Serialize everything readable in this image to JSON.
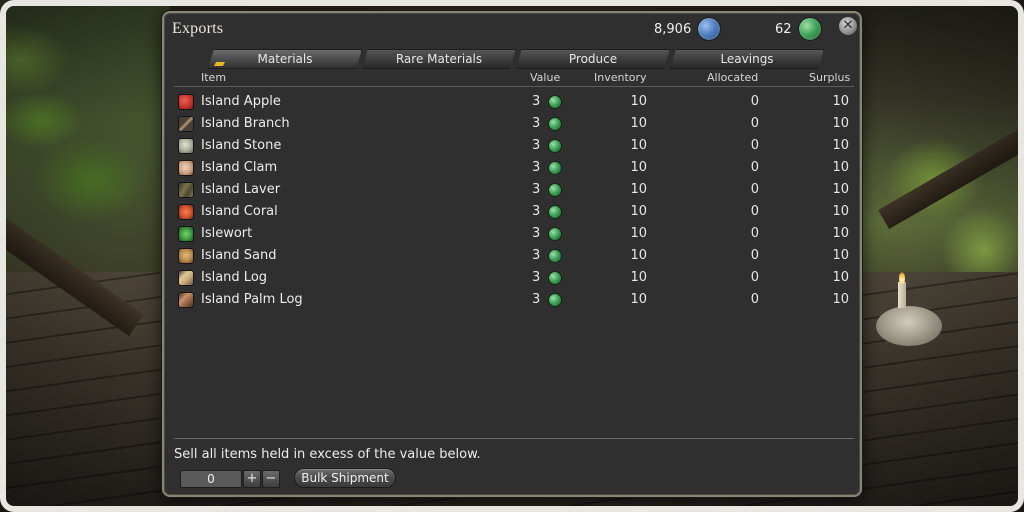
{
  "window": {
    "title": "Exports"
  },
  "currencies": [
    {
      "amount": "8,906",
      "icon": "seafarer-cowrie-icon",
      "color": "#4f7fc0"
    },
    {
      "amount": "62",
      "icon": "islander-cowrie-icon",
      "color": "#3fa55a"
    }
  ],
  "tabs": [
    {
      "label": "Materials",
      "active": true
    },
    {
      "label": "Rare Materials",
      "active": false
    },
    {
      "label": "Produce",
      "active": false
    },
    {
      "label": "Leavings",
      "active": false
    }
  ],
  "columns": {
    "item": "Item",
    "value": "Value",
    "inventory": "Inventory",
    "allocated": "Allocated",
    "surplus": "Surplus"
  },
  "items": [
    {
      "name": "Island Apple",
      "value": "3",
      "inventory": "10",
      "allocated": "0",
      "surplus": "10",
      "icon": "apple-icon",
      "color": "#c0302a"
    },
    {
      "name": "Island Branch",
      "value": "3",
      "inventory": "10",
      "allocated": "0",
      "surplus": "10",
      "icon": "branch-icon",
      "color": "#6e5a44"
    },
    {
      "name": "Island Stone",
      "value": "3",
      "inventory": "10",
      "allocated": "0",
      "surplus": "10",
      "icon": "stone-icon",
      "color": "#b8bca8"
    },
    {
      "name": "Island Clam",
      "value": "3",
      "inventory": "10",
      "allocated": "0",
      "surplus": "10",
      "icon": "clam-icon",
      "color": "#d8b49a"
    },
    {
      "name": "Island Laver",
      "value": "3",
      "inventory": "10",
      "allocated": "0",
      "surplus": "10",
      "icon": "laver-icon",
      "color": "#6a6440"
    },
    {
      "name": "Island Coral",
      "value": "3",
      "inventory": "10",
      "allocated": "0",
      "surplus": "10",
      "icon": "coral-icon",
      "color": "#d8502e"
    },
    {
      "name": "Islewort",
      "value": "3",
      "inventory": "10",
      "allocated": "0",
      "surplus": "10",
      "icon": "islewort-icon",
      "color": "#3e9a40"
    },
    {
      "name": "Island Sand",
      "value": "3",
      "inventory": "10",
      "allocated": "0",
      "surplus": "10",
      "icon": "sand-icon",
      "color": "#b88a4a"
    },
    {
      "name": "Island Log",
      "value": "3",
      "inventory": "10",
      "allocated": "0",
      "surplus": "10",
      "icon": "log-icon",
      "color": "#c8a878"
    },
    {
      "name": "Island Palm Log",
      "value": "3",
      "inventory": "10",
      "allocated": "0",
      "surplus": "10",
      "icon": "palm-log-icon",
      "color": "#9a6a4a"
    }
  ],
  "footer": {
    "instruction": "Sell all items held in excess of the value below.",
    "quantity": "0",
    "plus_label": "+",
    "minus_label": "−",
    "bulk_label": "Bulk Shipment"
  },
  "close_label": "✕"
}
